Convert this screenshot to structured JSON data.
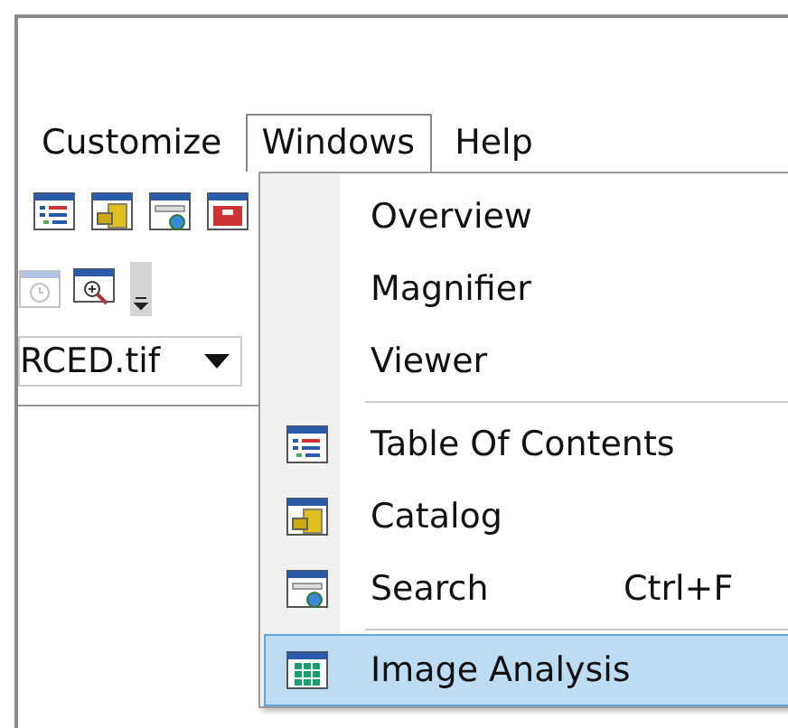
{
  "menu_bar": [
    {
      "label": "Customize",
      "selected": false
    },
    {
      "label": "Windows",
      "selected": true
    },
    {
      "label": "Help",
      "selected": false
    }
  ],
  "layer_combo": {
    "value": "RCED.tif"
  },
  "windows_menu": [
    {
      "kind": "item",
      "label": "Overview",
      "selected": false
    },
    {
      "kind": "item",
      "label": "Magnifier",
      "selected": false
    },
    {
      "kind": "item",
      "label": "Viewer",
      "selected": false
    },
    {
      "kind": "separator"
    },
    {
      "kind": "item",
      "label": "Table Of Contents",
      "selected": false
    },
    {
      "kind": "item",
      "label": "Catalog",
      "selected": false
    },
    {
      "kind": "item",
      "label": "Search",
      "shortcut": "Ctrl+F",
      "selected": false
    },
    {
      "kind": "separator"
    },
    {
      "kind": "item",
      "label": "Image Analysis",
      "selected": true
    }
  ]
}
